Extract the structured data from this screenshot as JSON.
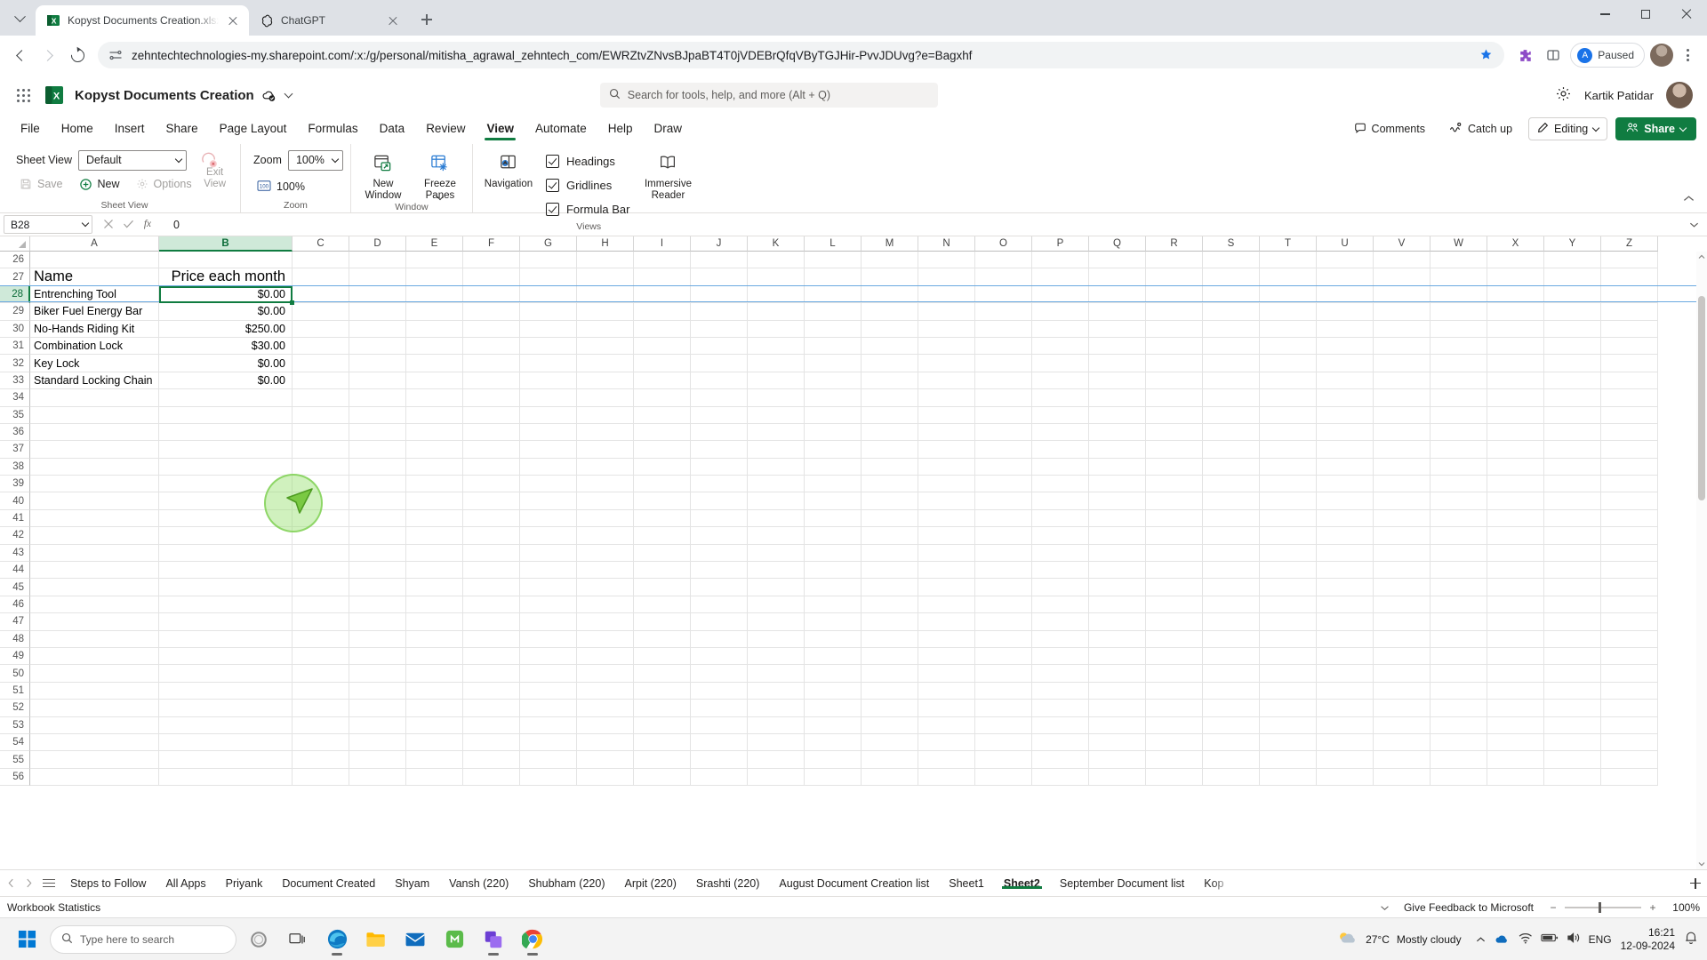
{
  "browser": {
    "tabs": [
      {
        "title": "Kopyst Documents Creation.xlsx",
        "favicon": "excel-icon",
        "active": true
      },
      {
        "title": "ChatGPT",
        "favicon": "chatgpt-icon",
        "active": false
      }
    ],
    "url": "zehntechtechnologies-my.sharepoint.com/:x:/g/personal/mitisha_agrawal_zehntech_com/EWRZtvZNvsBJpaBT4T0jVDEBrQfqVByTGJHir-PvvJDUvg?e=Bagxhf",
    "profile_label": "Paused",
    "profile_badge": "A",
    "icons": {
      "back": "back-arrow-icon",
      "forward": "forward-arrow-icon",
      "reload": "reload-icon",
      "site_info": "site-settings-icon",
      "bookmark": "star-icon",
      "extensions": "extensions-puzzle-icon",
      "split": "split-screen-icon",
      "menu": "three-dot-menu-icon",
      "tab_list": "tab-search-chevron-icon",
      "new_tab": "new-tab-plus-icon",
      "minimize": "window-minimize-icon",
      "maximize": "window-maximize-icon",
      "close": "window-close-icon"
    }
  },
  "app": {
    "title": "Kopyst Documents Creation",
    "autosave_icon": "autosave-cloud-icon",
    "title_chevron": "chevron-down-icon",
    "waffle_icon": "app-launcher-waffle-icon",
    "logo_icon": "excel-logo-icon",
    "search_placeholder": "Search for tools, help, and more (Alt + Q)",
    "search_icon": "search-icon",
    "settings_icon": "gear-icon",
    "user_name": "Kartik Patidar",
    "avatar": "user-avatar"
  },
  "ribbon_tabs": [
    {
      "label": "File",
      "active": false
    },
    {
      "label": "Home",
      "active": false
    },
    {
      "label": "Insert",
      "active": false
    },
    {
      "label": "Share",
      "active": false
    },
    {
      "label": "Page Layout",
      "active": false
    },
    {
      "label": "Formulas",
      "active": false
    },
    {
      "label": "Data",
      "active": false
    },
    {
      "label": "Review",
      "active": false
    },
    {
      "label": "View",
      "active": true
    },
    {
      "label": "Automate",
      "active": false
    },
    {
      "label": "Help",
      "active": false
    },
    {
      "label": "Draw",
      "active": false
    }
  ],
  "ribbon_right": {
    "comments": "Comments",
    "comments_icon": "comment-icon",
    "catch_up": "Catch up",
    "catch_up_icon": "catch-up-icon",
    "editing": "Editing",
    "editing_icon": "pencil-icon",
    "share": "Share",
    "share_icon": "share-people-icon",
    "collapse_icon": "chevron-up-icon"
  },
  "ribbon": {
    "groups": [
      {
        "name": "Sheet View",
        "label": "Sheet View",
        "sheet_view_label": "Sheet View",
        "sheet_view_value": "Default",
        "save_label": "Save",
        "save_icon": "save-icon",
        "new_label": "New",
        "new_icon": "new-sheet-view-icon",
        "options_label": "Options",
        "options_icon": "options-icon",
        "exit_label": "Exit\nView",
        "exit_icon": "exit-view-icon"
      },
      {
        "name": "Zoom",
        "label": "Zoom",
        "zoom_label": "Zoom",
        "zoom_value": "100%",
        "zoom100_label": "100%",
        "zoom100_icon": "zoom-100-icon"
      },
      {
        "name": "Window",
        "label": "Window",
        "new_window_label": "New\nWindow",
        "new_window_icon": "new-window-icon",
        "freeze_panes_label": "Freeze\nPanes",
        "freeze_panes_icon": "freeze-panes-icon"
      },
      {
        "name": "Views",
        "label": "Views",
        "navigation_label": "Navigation",
        "navigation_icon": "navigation-icon",
        "headings_label": "Headings",
        "headings_checked": true,
        "gridlines_label": "Gridlines",
        "gridlines_checked": true,
        "formula_bar_label": "Formula Bar",
        "formula_bar_checked": true,
        "immersive_reader_label": "Immersive\nReader",
        "immersive_reader_icon": "immersive-reader-icon"
      }
    ]
  },
  "formula_bar": {
    "name_box": "B28",
    "name_box_chevron": "chevron-down-icon",
    "cancel_icon": "cancel-x-icon",
    "enter_icon": "enter-check-icon",
    "function_icon": "insert-function-fx-icon",
    "value": "0",
    "expand_icon": "chevron-down-icon"
  },
  "grid": {
    "columns": [
      "A",
      "B",
      "C",
      "D",
      "E",
      "F",
      "G",
      "H",
      "I",
      "J",
      "K",
      "L",
      "M",
      "N",
      "O",
      "P",
      "Q",
      "R",
      "S",
      "T",
      "U",
      "V",
      "W",
      "X",
      "Y",
      "Z"
    ],
    "selected_column": "B",
    "first_row": 26,
    "last_row": 56,
    "selected_row": 28,
    "active_cell": "B28",
    "rows": [
      {
        "n": 26,
        "a": "",
        "b": ""
      },
      {
        "n": 27,
        "a": "Name",
        "b": "Price each month",
        "header": true
      },
      {
        "n": 28,
        "a": "Entrenching Tool",
        "b": "$0.00"
      },
      {
        "n": 29,
        "a": "Biker Fuel Energy Bar",
        "b": "$0.00"
      },
      {
        "n": 30,
        "a": "No-Hands Riding Kit",
        "b": "$250.00"
      },
      {
        "n": 31,
        "a": "Combination Lock",
        "b": "$30.00"
      },
      {
        "n": 32,
        "a": "Key Lock",
        "b": "$0.00"
      },
      {
        "n": 33,
        "a": "Standard Locking Chain",
        "b": "$0.00"
      },
      {
        "n": 34,
        "a": "",
        "b": ""
      },
      {
        "n": 35,
        "a": "",
        "b": ""
      },
      {
        "n": 36,
        "a": "",
        "b": ""
      },
      {
        "n": 37,
        "a": "",
        "b": ""
      },
      {
        "n": 38,
        "a": "",
        "b": ""
      },
      {
        "n": 39,
        "a": "",
        "b": ""
      },
      {
        "n": 40,
        "a": "",
        "b": ""
      },
      {
        "n": 41,
        "a": "",
        "b": ""
      },
      {
        "n": 42,
        "a": "",
        "b": ""
      },
      {
        "n": 43,
        "a": "",
        "b": ""
      },
      {
        "n": 44,
        "a": "",
        "b": ""
      },
      {
        "n": 45,
        "a": "",
        "b": ""
      },
      {
        "n": 46,
        "a": "",
        "b": ""
      },
      {
        "n": 47,
        "a": "",
        "b": ""
      },
      {
        "n": 48,
        "a": "",
        "b": ""
      },
      {
        "n": 49,
        "a": "",
        "b": ""
      },
      {
        "n": 50,
        "a": "",
        "b": ""
      },
      {
        "n": 51,
        "a": "",
        "b": ""
      },
      {
        "n": 52,
        "a": "",
        "b": ""
      },
      {
        "n": 53,
        "a": "",
        "b": ""
      },
      {
        "n": 54,
        "a": "",
        "b": ""
      },
      {
        "n": 55,
        "a": "",
        "b": ""
      },
      {
        "n": 56,
        "a": "",
        "b": ""
      }
    ]
  },
  "sheet_tabs": {
    "prev_icon": "previous-sheet-icon",
    "next_icon": "next-sheet-icon",
    "menu_icon": "all-sheets-menu-icon",
    "add_icon": "add-sheet-icon",
    "tabs": [
      {
        "label": "Steps to Follow",
        "active": false
      },
      {
        "label": "All Apps",
        "active": false
      },
      {
        "label": "Priyank",
        "active": false
      },
      {
        "label": "Document Created",
        "active": false
      },
      {
        "label": "Shyam",
        "active": false
      },
      {
        "label": "Vansh (220)",
        "active": false
      },
      {
        "label": "Shubham (220)",
        "active": false
      },
      {
        "label": "Arpit (220)",
        "active": false
      },
      {
        "label": "Srashti (220)",
        "active": false
      },
      {
        "label": "August Document Creation list",
        "active": false
      },
      {
        "label": "Sheet1",
        "active": false
      },
      {
        "label": "Sheet2",
        "active": true
      },
      {
        "label": "September Document list",
        "active": false
      },
      {
        "label": "Kop",
        "active": false,
        "clipped": true
      }
    ]
  },
  "status_bar": {
    "workbook_statistics": "Workbook Statistics",
    "feedback": "Give Feedback to Microsoft",
    "zoom_value": "100%",
    "zoom_out": "−",
    "zoom_in": "+",
    "expand_icon": "chevron-down-icon"
  },
  "taskbar": {
    "start_icon": "windows-start-icon",
    "search_placeholder": "Type here to search",
    "search_icon": "search-icon",
    "apps": [
      {
        "name": "task-view-icon"
      },
      {
        "name": "edge-icon"
      },
      {
        "name": "file-explorer-icon"
      },
      {
        "name": "mail-icon"
      },
      {
        "name": "store-icon"
      },
      {
        "name": "kopyst-icon"
      },
      {
        "name": "chrome-icon"
      }
    ],
    "weather_temp": "27°C",
    "weather_desc": "Mostly cloudy",
    "weather_icon": "cloud-icon",
    "language": "ENG",
    "time": "16:21",
    "date": "12-09-2024",
    "tray_icons": [
      "show-hidden-icons-chevron",
      "onedrive-icon",
      "network-icon",
      "battery-icon",
      "volume-icon",
      "notification-icon"
    ]
  },
  "colors": {
    "excel_green": "#107c41",
    "chrome_tabstrip": "#dee1e6",
    "selection_green": "#cfe9d9",
    "row_band_blue": "#6aa9e0",
    "cursor_halo": "#96e16e"
  }
}
